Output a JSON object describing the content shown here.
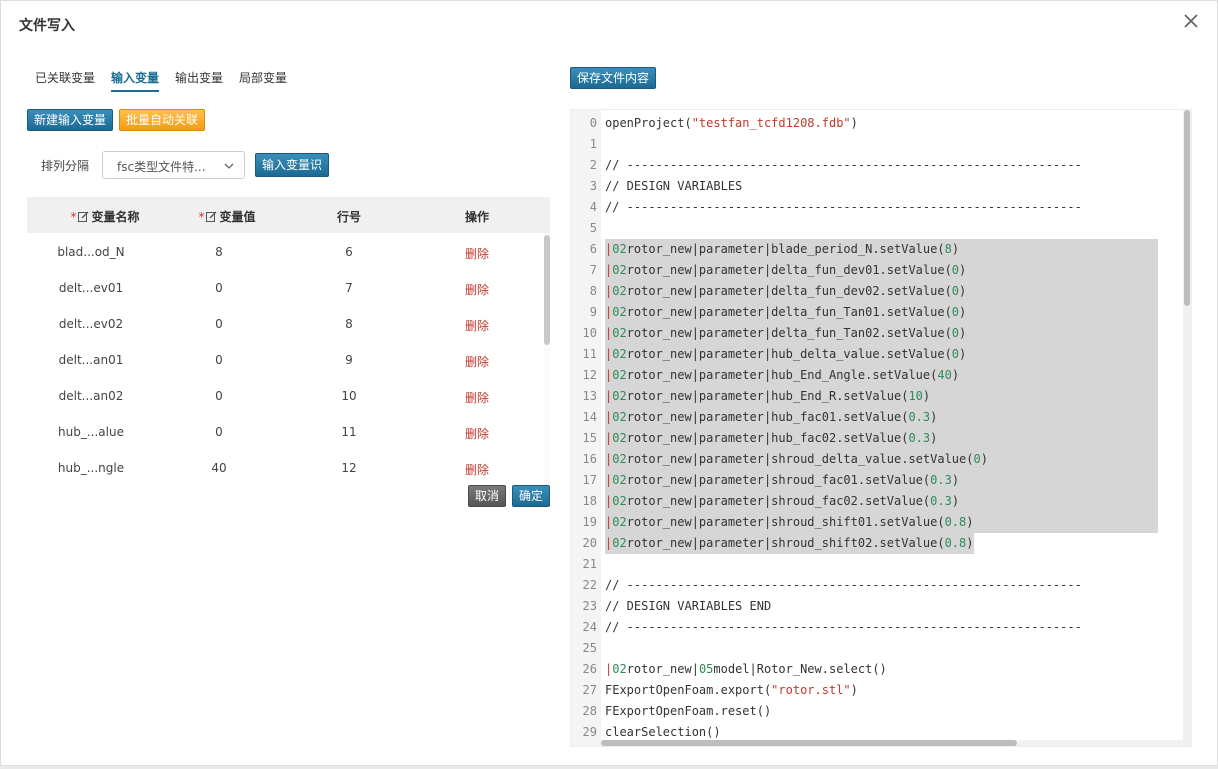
{
  "dialog": {
    "title": "文件写入"
  },
  "tabs": [
    {
      "label": "已关联变量"
    },
    {
      "label": "输入变量"
    },
    {
      "label": "输出变量"
    },
    {
      "label": "局部变量"
    }
  ],
  "buttons": {
    "new_input": "新建输入变量",
    "batch_link": "批量自动关联",
    "input_var_id": "输入变量识",
    "save_file": "保存文件内容",
    "cancel": "取消",
    "confirm": "确定"
  },
  "sort": {
    "label": "排列分隔",
    "selected": "fsc类型文件特..."
  },
  "table": {
    "headers": {
      "name": "变量名称",
      "value": "变量值",
      "line": "行号",
      "action": "操作"
    },
    "rows": [
      {
        "name": "blad...od_N",
        "value": "8",
        "line": "6",
        "action": "删除"
      },
      {
        "name": "delt...ev01",
        "value": "0",
        "line": "7",
        "action": "删除"
      },
      {
        "name": "delt...ev02",
        "value": "0",
        "line": "8",
        "action": "删除"
      },
      {
        "name": "delt...an01",
        "value": "0",
        "line": "9",
        "action": "删除"
      },
      {
        "name": "delt...an02",
        "value": "0",
        "line": "10",
        "action": "删除"
      },
      {
        "name": "hub_...alue",
        "value": "0",
        "line": "11",
        "action": "删除"
      },
      {
        "name": "hub_...ngle",
        "value": "40",
        "line": "12",
        "action": "删除"
      }
    ]
  },
  "editor": {
    "lines": [
      "openProject(\"testfan_tcfd1208.fdb\")",
      "",
      "// ---------------------------------------------------------------",
      "// DESIGN VARIABLES",
      "// ---------------------------------------------------------------",
      "",
      "|02rotor_new|parameter|blade_period_N.setValue(8)",
      "|02rotor_new|parameter|delta_fun_dev01.setValue(0)",
      "|02rotor_new|parameter|delta_fun_dev02.setValue(0)",
      "|02rotor_new|parameter|delta_fun_Tan01.setValue(0)",
      "|02rotor_new|parameter|delta_fun_Tan02.setValue(0)",
      "|02rotor_new|parameter|hub_delta_value.setValue(0)",
      "|02rotor_new|parameter|hub_End_Angle.setValue(40)",
      "|02rotor_new|parameter|hub_End_R.setValue(10)",
      "|02rotor_new|parameter|hub_fac01.setValue(0.3)",
      "|02rotor_new|parameter|hub_fac02.setValue(0.3)",
      "|02rotor_new|parameter|shroud_delta_value.setValue(0)",
      "|02rotor_new|parameter|shroud_fac01.setValue(0.3)",
      "|02rotor_new|parameter|shroud_fac02.setValue(0.3)",
      "|02rotor_new|parameter|shroud_shift01.setValue(0.8)",
      "|02rotor_new|parameter|shroud_shift02.setValue(0.8)",
      "",
      "// ---------------------------------------------------------------",
      "// DESIGN VARIABLES END",
      "// ---------------------------------------------------------------",
      "",
      "|02rotor_new|05model|Rotor_New.select()",
      "FExportOpenFoam.export(\"rotor.stl\")",
      "FExportOpenFoam.reset()",
      "clearSelection()"
    ],
    "highlighted_lines": [
      6,
      20
    ]
  },
  "colors": {
    "accent": "#1d6d95",
    "delete": "#c0392b",
    "orange": "#f49b12"
  }
}
